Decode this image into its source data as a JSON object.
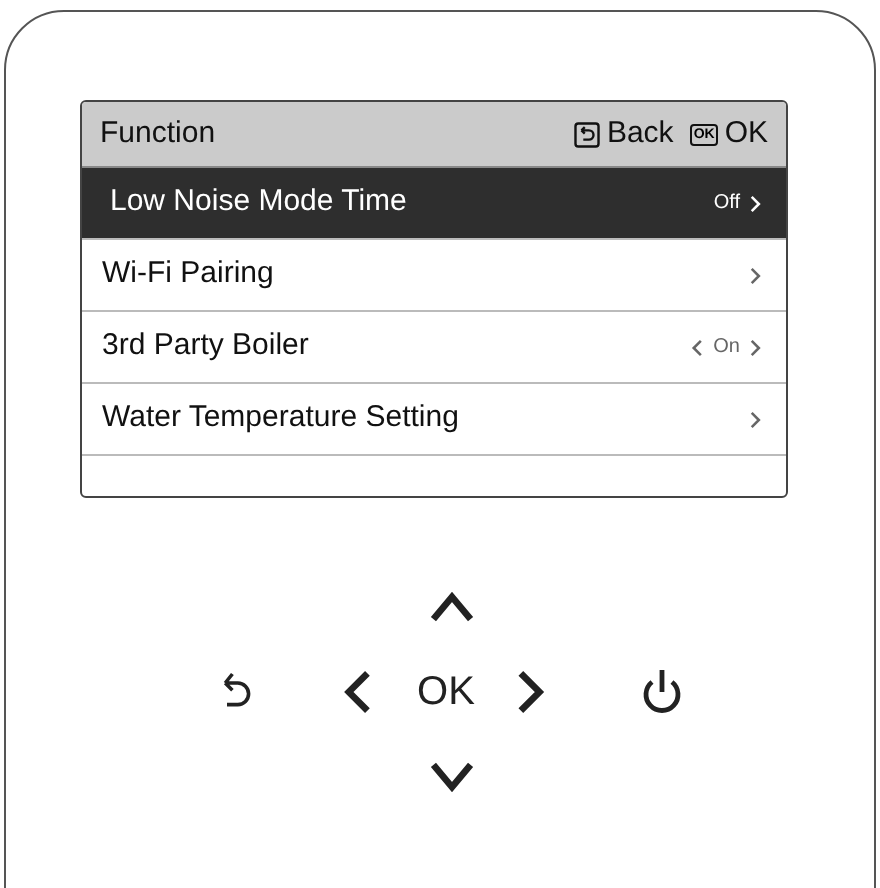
{
  "screen": {
    "title": "Function",
    "hints": [
      {
        "kind": "back",
        "label": "Back"
      },
      {
        "kind": "ok",
        "key": "OK",
        "label": "OK"
      }
    ],
    "rows": [
      {
        "label": "Low Noise Mode Time",
        "value": "Off",
        "kind": "link",
        "selected": true
      },
      {
        "label": "Wi-Fi Pairing",
        "kind": "link",
        "selected": false
      },
      {
        "label": "3rd Party Boiler",
        "value": "On",
        "kind": "toggle",
        "selected": false
      },
      {
        "label": "Water Temperature Setting",
        "kind": "link",
        "selected": false
      }
    ]
  },
  "keypad": {
    "ok_label": "OK"
  }
}
